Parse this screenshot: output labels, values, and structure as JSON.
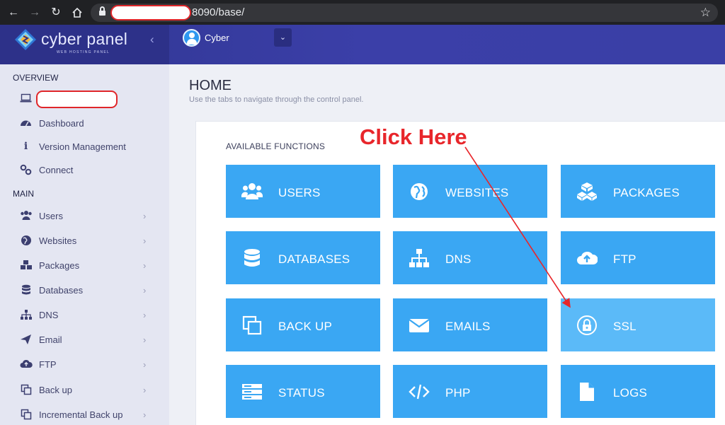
{
  "browser": {
    "url_suffix": "8090/base/"
  },
  "header": {
    "logo_text": "cyber panel",
    "logo_subtitle": "WEB HOSTING PANEL",
    "username": "Cyber"
  },
  "sidebar": {
    "overview_title": "OVERVIEW",
    "main_title": "MAIN",
    "overview_items": [
      {
        "label": "",
        "icon": "laptop-icon"
      },
      {
        "label": "Dashboard",
        "icon": "dashboard-icon"
      },
      {
        "label": "Version Management",
        "icon": "info-icon"
      },
      {
        "label": "Connect",
        "icon": "link-icon"
      }
    ],
    "main_items": [
      {
        "label": "Users",
        "icon": "users-icon"
      },
      {
        "label": "Websites",
        "icon": "globe-icon"
      },
      {
        "label": "Packages",
        "icon": "cubes-icon"
      },
      {
        "label": "Databases",
        "icon": "database-icon"
      },
      {
        "label": "DNS",
        "icon": "sitemap-icon"
      },
      {
        "label": "Email",
        "icon": "paper-plane-icon"
      },
      {
        "label": "FTP",
        "icon": "cloud-upload-icon"
      },
      {
        "label": "Back up",
        "icon": "copy-icon"
      },
      {
        "label": "Incremental Back up",
        "icon": "copy-icon"
      }
    ]
  },
  "main": {
    "title": "HOME",
    "subtitle": "Use the tabs to navigate through the control panel.",
    "panel_title": "AVAILABLE FUNCTIONS",
    "tiles": [
      {
        "label": "USERS",
        "icon": "users-icon"
      },
      {
        "label": "WEBSITES",
        "icon": "globe-icon"
      },
      {
        "label": "PACKAGES",
        "icon": "cubes-icon"
      },
      {
        "label": "DATABASES",
        "icon": "database-icon"
      },
      {
        "label": "DNS",
        "icon": "sitemap-icon"
      },
      {
        "label": "FTP",
        "icon": "cloud-upload-icon"
      },
      {
        "label": "BACK UP",
        "icon": "copy-icon"
      },
      {
        "label": "EMAILS",
        "icon": "envelope-icon"
      },
      {
        "label": "SSL",
        "icon": "lock-icon"
      },
      {
        "label": "STATUS",
        "icon": "server-icon"
      },
      {
        "label": "PHP",
        "icon": "code-icon"
      },
      {
        "label": "LOGS",
        "icon": "file-icon"
      }
    ]
  },
  "annotation": {
    "text": "Click Here",
    "color": "#e8262b"
  },
  "colors": {
    "tile": "#3aa7f3",
    "tile_highlight": "#5bbaf8",
    "header": "#3b3fa8"
  }
}
